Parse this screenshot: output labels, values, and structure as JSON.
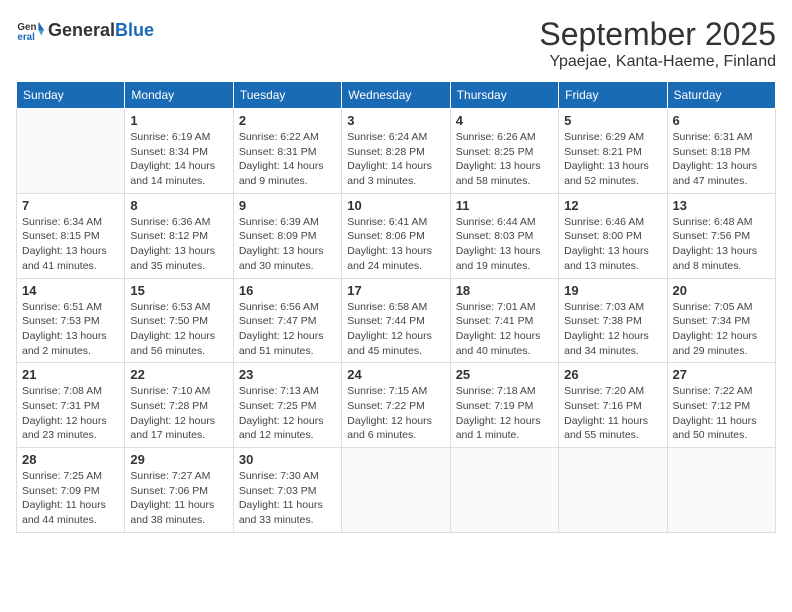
{
  "header": {
    "logo_general": "General",
    "logo_blue": "Blue",
    "month": "September 2025",
    "location": "Ypaejae, Kanta-Haeme, Finland"
  },
  "days_of_week": [
    "Sunday",
    "Monday",
    "Tuesday",
    "Wednesday",
    "Thursday",
    "Friday",
    "Saturday"
  ],
  "weeks": [
    [
      {
        "day": "",
        "info": ""
      },
      {
        "day": "1",
        "info": "Sunrise: 6:19 AM\nSunset: 8:34 PM\nDaylight: 14 hours\nand 14 minutes."
      },
      {
        "day": "2",
        "info": "Sunrise: 6:22 AM\nSunset: 8:31 PM\nDaylight: 14 hours\nand 9 minutes."
      },
      {
        "day": "3",
        "info": "Sunrise: 6:24 AM\nSunset: 8:28 PM\nDaylight: 14 hours\nand 3 minutes."
      },
      {
        "day": "4",
        "info": "Sunrise: 6:26 AM\nSunset: 8:25 PM\nDaylight: 13 hours\nand 58 minutes."
      },
      {
        "day": "5",
        "info": "Sunrise: 6:29 AM\nSunset: 8:21 PM\nDaylight: 13 hours\nand 52 minutes."
      },
      {
        "day": "6",
        "info": "Sunrise: 6:31 AM\nSunset: 8:18 PM\nDaylight: 13 hours\nand 47 minutes."
      }
    ],
    [
      {
        "day": "7",
        "info": "Sunrise: 6:34 AM\nSunset: 8:15 PM\nDaylight: 13 hours\nand 41 minutes."
      },
      {
        "day": "8",
        "info": "Sunrise: 6:36 AM\nSunset: 8:12 PM\nDaylight: 13 hours\nand 35 minutes."
      },
      {
        "day": "9",
        "info": "Sunrise: 6:39 AM\nSunset: 8:09 PM\nDaylight: 13 hours\nand 30 minutes."
      },
      {
        "day": "10",
        "info": "Sunrise: 6:41 AM\nSunset: 8:06 PM\nDaylight: 13 hours\nand 24 minutes."
      },
      {
        "day": "11",
        "info": "Sunrise: 6:44 AM\nSunset: 8:03 PM\nDaylight: 13 hours\nand 19 minutes."
      },
      {
        "day": "12",
        "info": "Sunrise: 6:46 AM\nSunset: 8:00 PM\nDaylight: 13 hours\nand 13 minutes."
      },
      {
        "day": "13",
        "info": "Sunrise: 6:48 AM\nSunset: 7:56 PM\nDaylight: 13 hours\nand 8 minutes."
      }
    ],
    [
      {
        "day": "14",
        "info": "Sunrise: 6:51 AM\nSunset: 7:53 PM\nDaylight: 13 hours\nand 2 minutes."
      },
      {
        "day": "15",
        "info": "Sunrise: 6:53 AM\nSunset: 7:50 PM\nDaylight: 12 hours\nand 56 minutes."
      },
      {
        "day": "16",
        "info": "Sunrise: 6:56 AM\nSunset: 7:47 PM\nDaylight: 12 hours\nand 51 minutes."
      },
      {
        "day": "17",
        "info": "Sunrise: 6:58 AM\nSunset: 7:44 PM\nDaylight: 12 hours\nand 45 minutes."
      },
      {
        "day": "18",
        "info": "Sunrise: 7:01 AM\nSunset: 7:41 PM\nDaylight: 12 hours\nand 40 minutes."
      },
      {
        "day": "19",
        "info": "Sunrise: 7:03 AM\nSunset: 7:38 PM\nDaylight: 12 hours\nand 34 minutes."
      },
      {
        "day": "20",
        "info": "Sunrise: 7:05 AM\nSunset: 7:34 PM\nDaylight: 12 hours\nand 29 minutes."
      }
    ],
    [
      {
        "day": "21",
        "info": "Sunrise: 7:08 AM\nSunset: 7:31 PM\nDaylight: 12 hours\nand 23 minutes."
      },
      {
        "day": "22",
        "info": "Sunrise: 7:10 AM\nSunset: 7:28 PM\nDaylight: 12 hours\nand 17 minutes."
      },
      {
        "day": "23",
        "info": "Sunrise: 7:13 AM\nSunset: 7:25 PM\nDaylight: 12 hours\nand 12 minutes."
      },
      {
        "day": "24",
        "info": "Sunrise: 7:15 AM\nSunset: 7:22 PM\nDaylight: 12 hours\nand 6 minutes."
      },
      {
        "day": "25",
        "info": "Sunrise: 7:18 AM\nSunset: 7:19 PM\nDaylight: 12 hours\nand 1 minute."
      },
      {
        "day": "26",
        "info": "Sunrise: 7:20 AM\nSunset: 7:16 PM\nDaylight: 11 hours\nand 55 minutes."
      },
      {
        "day": "27",
        "info": "Sunrise: 7:22 AM\nSunset: 7:12 PM\nDaylight: 11 hours\nand 50 minutes."
      }
    ],
    [
      {
        "day": "28",
        "info": "Sunrise: 7:25 AM\nSunset: 7:09 PM\nDaylight: 11 hours\nand 44 minutes."
      },
      {
        "day": "29",
        "info": "Sunrise: 7:27 AM\nSunset: 7:06 PM\nDaylight: 11 hours\nand 38 minutes."
      },
      {
        "day": "30",
        "info": "Sunrise: 7:30 AM\nSunset: 7:03 PM\nDaylight: 11 hours\nand 33 minutes."
      },
      {
        "day": "",
        "info": ""
      },
      {
        "day": "",
        "info": ""
      },
      {
        "day": "",
        "info": ""
      },
      {
        "day": "",
        "info": ""
      }
    ]
  ]
}
